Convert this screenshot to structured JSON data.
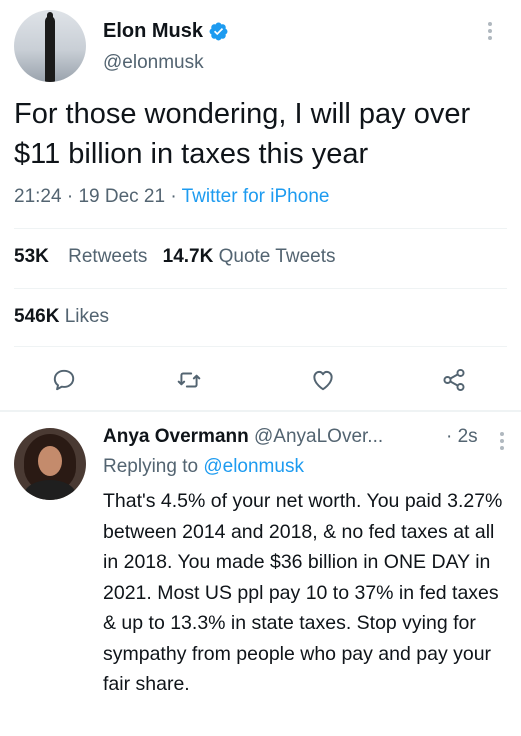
{
  "tweet": {
    "author": {
      "name": "Elon Musk",
      "handle": "@elonmusk",
      "verified": true
    },
    "text": "For those wondering, I will pay over $11 billion in taxes this year",
    "time": "21:24",
    "date": "19 Dec 21",
    "source": "Twitter for iPhone",
    "separator": "·",
    "stats": {
      "retweets_count": "53K",
      "retweets_label": "Retweets",
      "quote_count": "14.7K",
      "quote_label": "Quote Tweets",
      "likes_count": "546K",
      "likes_label": "Likes"
    },
    "actions": [
      "reply-icon",
      "retweet-icon",
      "like-icon",
      "share-icon"
    ]
  },
  "reply": {
    "name": "Anya Overmann",
    "handle": "@AnyaLOver...",
    "time_sep": "·",
    "time": "2s",
    "replying_prefix": "Replying to",
    "replying_to": "@elonmusk",
    "text": "That's 4.5% of your net worth. You paid 3.27% between 2014 and 2018, & no fed taxes at all in 2018. You made $36 billion in ONE DAY in 2021. Most US ppl pay 10 to 37% in fed taxes & up to 13.3% in state taxes. Stop vying for sympathy from people who pay and pay your fair share."
  },
  "colors": {
    "text": "#0f1419",
    "secondary": "#536471",
    "accent": "#1d9bf0",
    "divider": "#eff3f4"
  }
}
